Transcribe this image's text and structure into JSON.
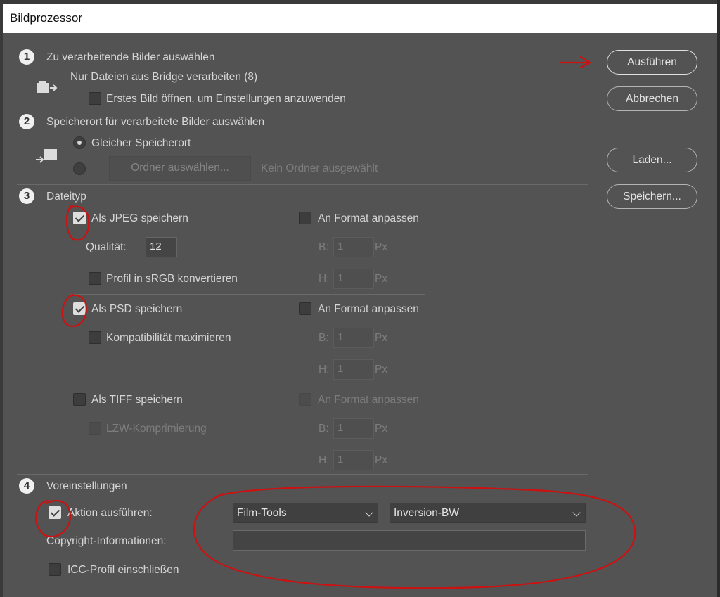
{
  "window": {
    "title": "Bildprozessor"
  },
  "buttons": {
    "run": "Ausführen",
    "cancel": "Abbrechen",
    "load": "Laden...",
    "save": "Speichern..."
  },
  "section1": {
    "number": "1",
    "title": "Zu verarbeitende Bilder auswählen",
    "info": "Nur Dateien aus Bridge verarbeiten (8)",
    "open_first": "Erstes Bild öffnen, um Einstellungen anzuwenden"
  },
  "section2": {
    "number": "2",
    "title": "Speicherort für verarbeitete Bilder auswählen",
    "same_location": "Gleicher Speicherort",
    "choose_folder": "Ordner auswählen...",
    "no_folder": "Kein Ordner ausgewählt"
  },
  "section3": {
    "number": "3",
    "title": "Dateityp",
    "jpeg": {
      "label": "Als JPEG speichern",
      "checked": true,
      "resize": "An Format anpassen",
      "quality_label": "Qualität:",
      "quality_value": "12",
      "srgb": "Profil in sRGB konvertieren",
      "w_label": "B:",
      "h_label": "H:",
      "w_value": "1",
      "h_value": "1",
      "unit": "Px"
    },
    "psd": {
      "label": "Als PSD speichern",
      "checked": true,
      "resize": "An Format anpassen",
      "max_compat": "Kompatibilität maximieren",
      "w_label": "B:",
      "h_label": "H:",
      "w_value": "1",
      "h_value": "1",
      "unit": "Px"
    },
    "tiff": {
      "label": "Als TIFF speichern",
      "checked": false,
      "resize": "An Format anpassen",
      "lzw": "LZW-Komprimierung",
      "w_label": "B:",
      "h_label": "H:",
      "w_value": "1",
      "h_value": "1",
      "unit": "Px"
    }
  },
  "section4": {
    "number": "4",
    "title": "Voreinstellungen",
    "run_action": "Aktion ausführen:",
    "action_set": "Film-Tools",
    "action": "Inversion-BW",
    "copyright_label": "Copyright-Informationen:",
    "copyright_value": "",
    "icc": "ICC-Profil einschließen"
  },
  "annotation_color": "#cc1111"
}
